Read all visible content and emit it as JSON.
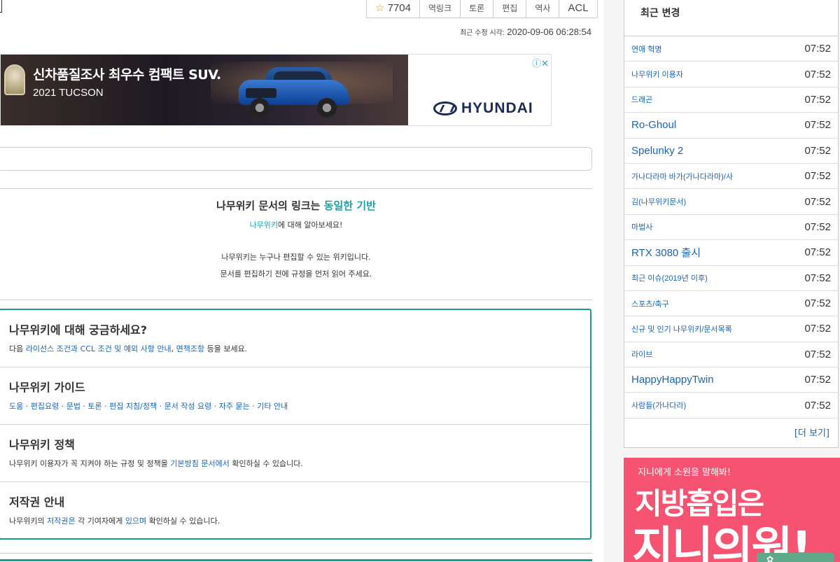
{
  "toolbar": {
    "star_icon": "star-icon",
    "star_count": "7704",
    "btn_backlinks": "역링크",
    "btn_discuss": "토론",
    "btn_edit": "편집",
    "btn_history": "역사",
    "btn_acl": "ACL"
  },
  "updated": {
    "label": "최근 수정 시각:",
    "value": "2020-09-06 06:28:54"
  },
  "ad": {
    "headline": "신차품질조사 최우수 컴팩트 SUV.",
    "model": "2021 TUCSON",
    "info_icon": "ⓘ✕",
    "brand": "HYUNDAI"
  },
  "notice": {
    "line1_prefix": "나무위키 문서의 링크는",
    "line1_link": "동일한 기반",
    "line2_link": "나무위키",
    "line2_rest": "에 대해 알아보세요!",
    "line3": "나무위키는 누구나 편집할 수 있는 위키입니다.",
    "line4": "문서를 편집하기 전에 규정을 먼저 읽어 주세요."
  },
  "info": [
    {
      "heading": "나무위키에 대해 궁금하세요?",
      "desc_prefix": "다음",
      "desc_link": "라이선스 조건과 CCL 조건 및 예외 사항 안내",
      "desc_link2": "면책조항",
      "desc_suffix": "등을 보세요."
    },
    {
      "heading": "나무위키 가이드",
      "links": "도움 · 편집요령 · 문법 · 토론 · 편집 지침/정책 · 문서 작성 요령 · 자주 묻는 · 기타 안내"
    },
    {
      "heading": "나무위키 정책",
      "desc": "나무위키 이용자가 꼭 지켜야 하는 규정 및 정책을",
      "desc_link": "기본방침 문서에서",
      "desc_suffix": "확인하실 수 있습니다."
    },
    {
      "heading": "저작권 안내",
      "desc_prefix": "나무위키의",
      "desc_link": "저작권은",
      "desc_mid": "각 기여자에게",
      "desc_link2": "있으며",
      "desc_suffix": "확인하실 수 있습니다."
    }
  ],
  "sidebar": {
    "title": "최근 변경",
    "items": [
      {
        "name": "연애 혁명",
        "time": "07:52"
      },
      {
        "name": "나무위키 이용자",
        "time": "07:52"
      },
      {
        "name": "드래곤",
        "time": "07:52"
      },
      {
        "name": "Ro-Ghoul",
        "time": "07:52"
      },
      {
        "name": "Spelunky 2",
        "time": "07:52"
      },
      {
        "name": "가나다라마 바가(가나다라마)/사",
        "time": "07:52"
      },
      {
        "name": "김(나무위키문서)",
        "time": "07:52"
      },
      {
        "name": "마법사",
        "time": "07:52"
      },
      {
        "name": "RTX 3080 출시",
        "time": "07:52"
      },
      {
        "name": "최근 이슈(2019년 이후)",
        "time": "07:52"
      },
      {
        "name": "스포츠/축구",
        "time": "07:52"
      },
      {
        "name": "신규 및 인기 나무위키/문서목록",
        "time": "07:52"
      },
      {
        "name": "라이브",
        "time": "07:52"
      },
      {
        "name": "HappyHappyTwin",
        "time": "07:52"
      },
      {
        "name": "사람들(가나다라)",
        "time": "07:52"
      }
    ],
    "more": "[더 보기]"
  },
  "banner": {
    "small": "지니에게 소원을 말해봐!",
    "big1": "지방흡입은",
    "big2": "지니의원!"
  }
}
